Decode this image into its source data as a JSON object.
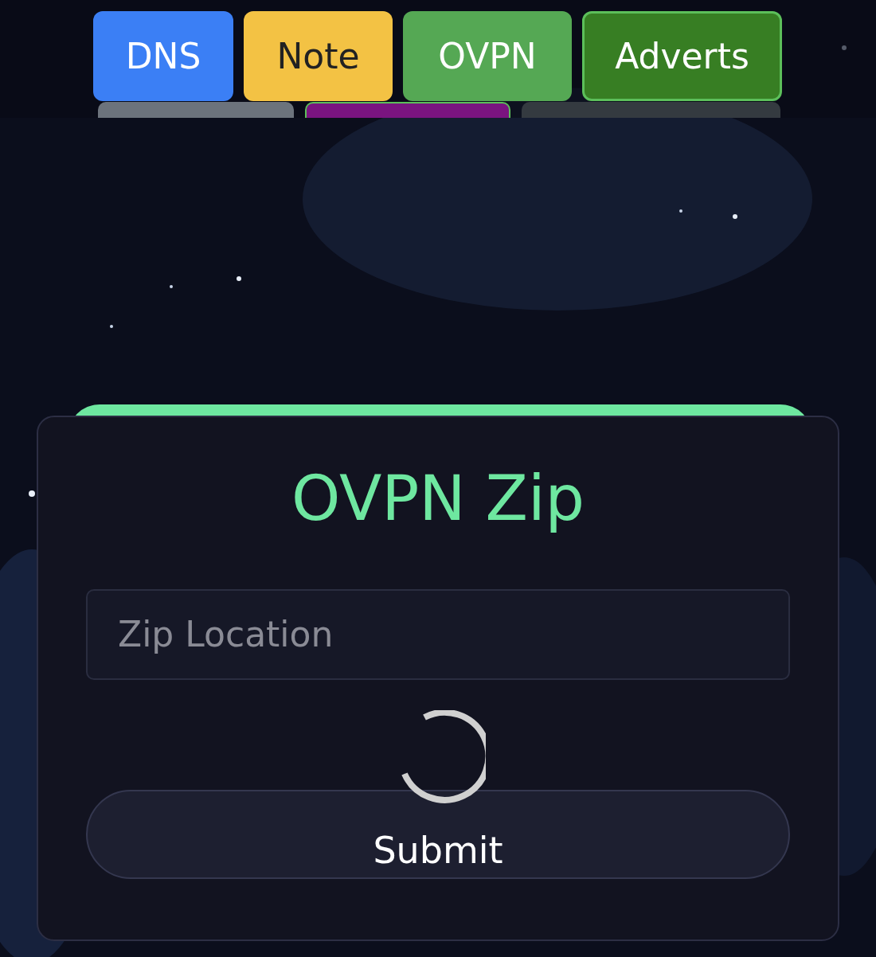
{
  "tabs": [
    {
      "label": "DNS",
      "color": "#3b7ff5",
      "selected": false
    },
    {
      "label": "Note",
      "color": "#f3c244",
      "selected": false
    },
    {
      "label": "OVPN",
      "color": "#55a854",
      "selected": false
    },
    {
      "label": "Adverts",
      "color": "#377e23",
      "selected": true
    }
  ],
  "subtabs": [
    {
      "color": "#6c737c",
      "selected": false
    },
    {
      "color": "#7a1480",
      "selected": true
    },
    {
      "color": "#343a40",
      "selected": false
    }
  ],
  "card": {
    "title": "OVPN Zip",
    "field": {
      "placeholder": "Zip Location"
    },
    "loading": true,
    "button": "Submit"
  }
}
